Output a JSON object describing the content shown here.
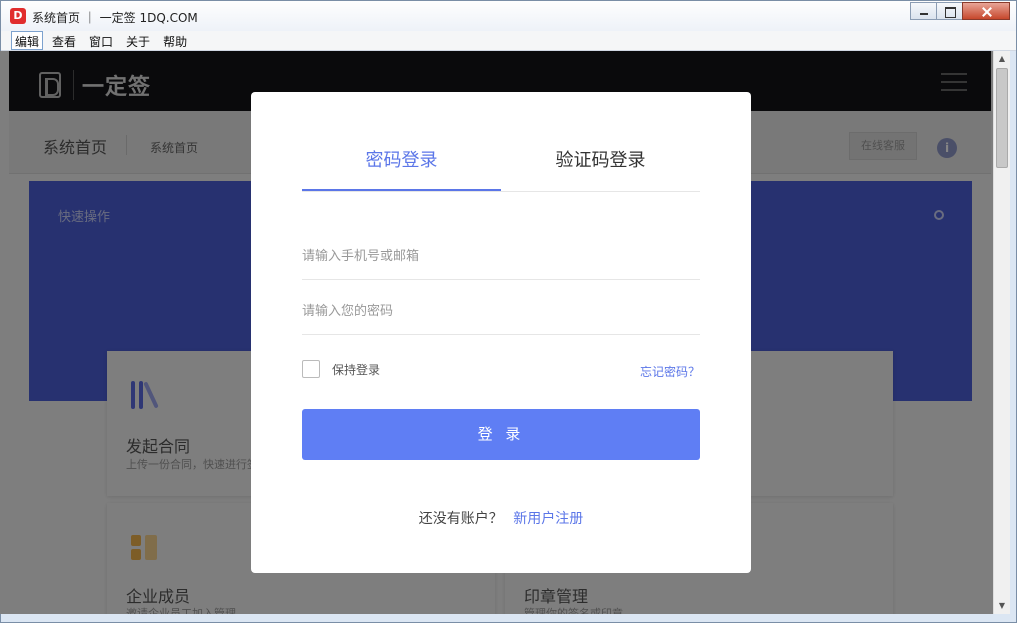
{
  "window": {
    "title": "系统首页 ｜ 一定签 1DQ.COM",
    "icon_letter": "D"
  },
  "menu": [
    "编辑",
    "查看",
    "窗口",
    "关于",
    "帮助"
  ],
  "header": {
    "logo_text": "一定签"
  },
  "subheader": {
    "crumb_main": "系统首页",
    "crumb_sub": "系统首页",
    "online_service": "在线客服",
    "info": "i"
  },
  "banner": {
    "title": "快速操作"
  },
  "cards": [
    {
      "title": "发起合同",
      "desc": "上传一份合同，快速进行签"
    },
    {
      "title": "企业成员",
      "desc": "邀请企业员工加入管理"
    },
    {
      "title": "印章管理",
      "desc": "管理你的签名或印章"
    }
  ],
  "dialog": {
    "tab_password": "密码登录",
    "tab_code": "验证码登录",
    "account_placeholder": "请输入手机号或邮箱",
    "password_placeholder": "请输入您的密码",
    "remember_label": "保持登录",
    "forgot_label": "忘记密码？",
    "login_button": "登 录",
    "no_account_text": "还没有账户？",
    "register_link": "新用户注册"
  },
  "colors": {
    "accent": "#5b76e8",
    "button": "#5f7ef4",
    "banner": "#4b5ed6",
    "header": "#141418"
  }
}
